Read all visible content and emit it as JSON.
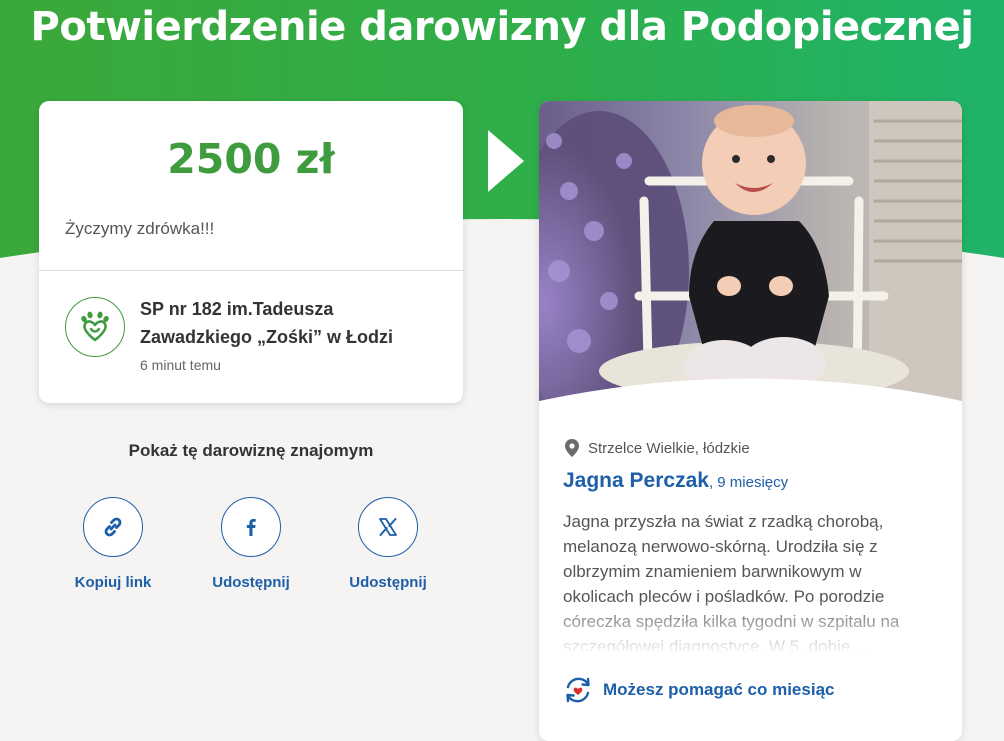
{
  "header": {
    "title": "Potwierdzenie darowizny dla Podopiecznej"
  },
  "colors": {
    "brand_green": "#3e9b3e",
    "link_blue": "#1d5fa8",
    "background": "#f6f4f2"
  },
  "donation": {
    "amount": "2500 zł",
    "message": "Życzymy zdrówka!!!",
    "donor_name": "SP nr 182 im.Tadeusza Zawadzkiego „Zośki” w Łodzi",
    "time_ago": "6 minut temu",
    "donor_icon": "heart-hand-icon"
  },
  "share": {
    "title": "Pokaż tę darowiznę znajomym",
    "items": [
      {
        "label": "Kopiuj link",
        "icon": "link-icon"
      },
      {
        "label": "Udostępnij",
        "icon": "facebook-icon"
      },
      {
        "label": "Udostępnij",
        "icon": "x-icon"
      }
    ]
  },
  "beneficiary": {
    "location": "Strzelce Wielkie, łódzkie",
    "name": "Jagna Perczak",
    "age": "9 miesięcy",
    "description": "Jagna przyszła na świat z rzadką chorobą, melanozą nerwowo-skórną. Urodziła się z olbrzymim znamieniem barwnikowym w okolicach pleców i pośladków. Po porodzie córeczka spędziła kilka tygodni w szpitalu na szczegółowej diagnostyce. W 5. dobie…",
    "monthly_label": "Możesz pomagać co miesiąc",
    "photo_icon": "baby-photo"
  }
}
